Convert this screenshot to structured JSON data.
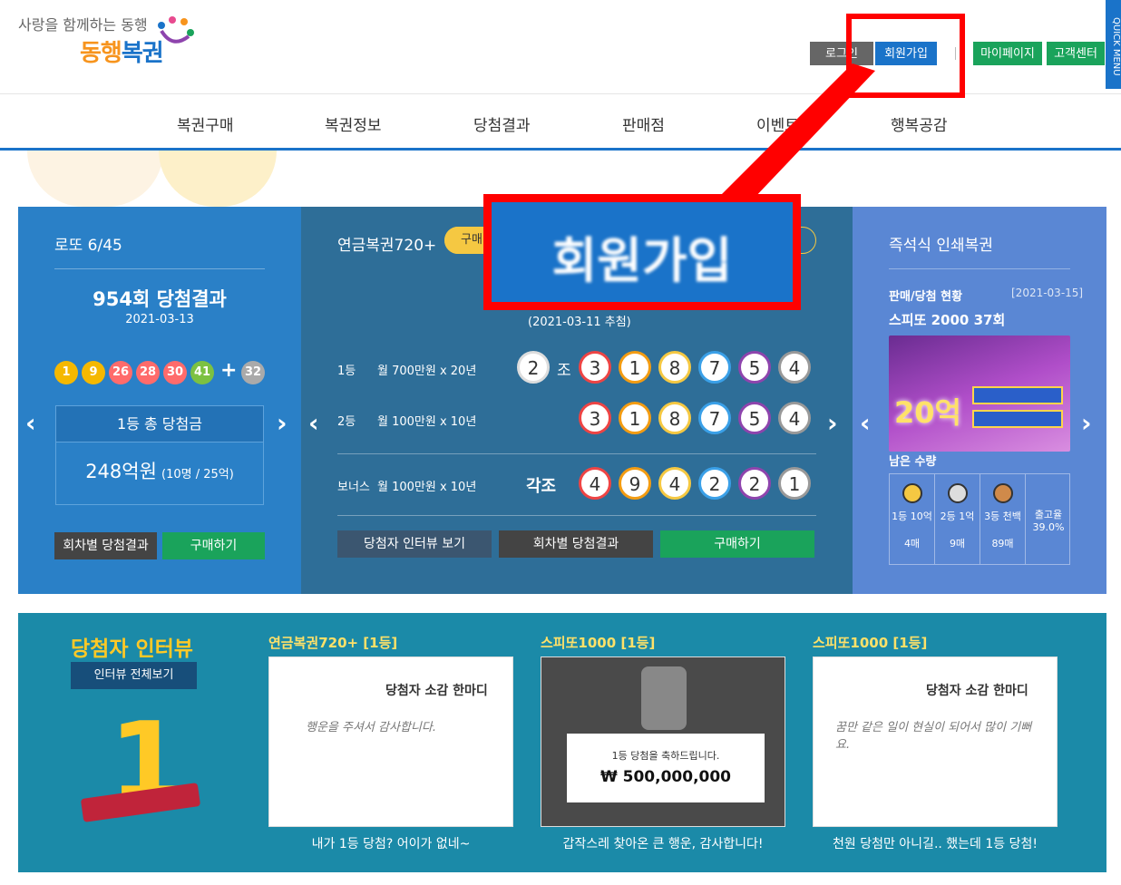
{
  "header": {
    "slogan": "사랑을 함께하는 동행",
    "brand_a": "동행",
    "brand_b": "복권",
    "login": "로그인",
    "join": "회원가입",
    "mypage": "마이페이지",
    "cs": "고객센터",
    "quick": "QUICK MENU"
  },
  "nav": [
    "복권구매",
    "복권정보",
    "당첨결과",
    "판매점",
    "이벤트",
    "행복공감"
  ],
  "lotto": {
    "title": "로또 6/45",
    "round": "954회 당첨결과",
    "date": "2021-03-13",
    "balls": [
      "1",
      "9",
      "26",
      "28",
      "30",
      "41"
    ],
    "plus": "+",
    "bonus": "32",
    "prize_label": "1등 총 당첨금",
    "prize": "248억원",
    "prize_sub": "(10명 / 25억)",
    "btn_history": "회차별 당첨결과",
    "btn_buy": "구매하기"
  },
  "pension": {
    "title": "연금복권720+",
    "tag": "구매",
    "draw_date": "(2021-03-11 추첨)",
    "rank1": "1등",
    "rank1_desc": "월 700만원 x 20년",
    "group": "2",
    "jo": "조",
    "rank1_nums": [
      "3",
      "1",
      "8",
      "7",
      "5",
      "4"
    ],
    "rank2": "2등",
    "rank2_desc": "월 100만원 x 10년",
    "rank2_nums": [
      "3",
      "1",
      "8",
      "7",
      "5",
      "4"
    ],
    "bonus": "보너스",
    "bonus_desc": "월 100만원 x 10년",
    "each": "각조",
    "bonus_nums": [
      "4",
      "9",
      "4",
      "2",
      "2",
      "1"
    ],
    "btn_interview": "당첨자 인터뷰 보기",
    "btn_history": "회차별 당첨결과",
    "btn_buy": "구매하기"
  },
  "instant": {
    "title": "즉석식 인쇄복권",
    "status": "판매/당첨 현황",
    "status_date": "[2021-03-15]",
    "game": "스피또 2000 37회",
    "ticket_amount": "20억",
    "remaining": "남은 수량",
    "cols": [
      {
        "rank": "1등 10억",
        "count": "4매"
      },
      {
        "rank": "2등 1억",
        "count": "9매"
      },
      {
        "rank": "3등 천백",
        "count": "89매"
      }
    ],
    "rate_label": "출고율",
    "rate": "39.0%"
  },
  "interview": {
    "title": "당첨자 인터뷰",
    "btn_all": "인터뷰 전체보기",
    "cards": [
      {
        "label": "연금복권720+ [1등]",
        "caption": "내가 1등 당첨? 어이가 없네~",
        "head": "당첨자 소감 한마디",
        "hand": "행운을 주셔서 감사합니다."
      },
      {
        "label": "스피또1000 [1등]",
        "caption": "갑작스레 찾아온 큰 행운, 감사합니다!",
        "board_title": "1등 당첨을 축하드립니다.",
        "board_amount": "₩ 500,000,000"
      },
      {
        "label": "스피또1000 [1등]",
        "caption": "천원 당첨만 아니길.. 했는데 1등 당첨!",
        "head": "당첨자 소감 한마디",
        "hand": "꿈만 같은 일이 현실이 되어서 많이 기뻐요."
      }
    ]
  },
  "callout": {
    "text": "회원가입"
  },
  "colors": {
    "accent": "#1a73c9",
    "green": "#1aa35b",
    "highlight": "#ff0000"
  }
}
